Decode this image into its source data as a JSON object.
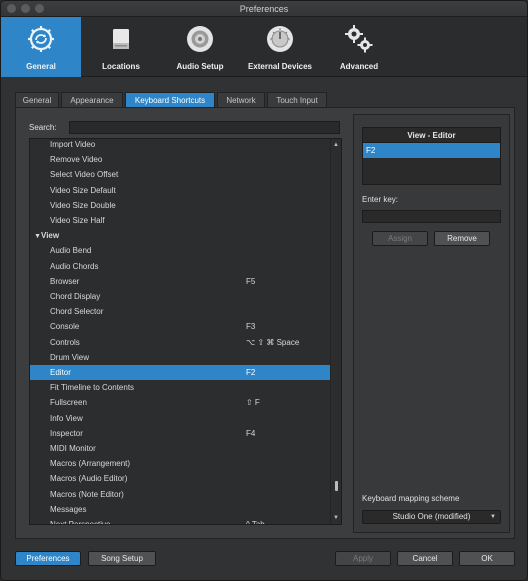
{
  "window": {
    "title": "Preferences"
  },
  "categories": [
    {
      "label": "General",
      "icon": "general-gear-icon"
    },
    {
      "label": "Locations",
      "icon": "hard-drive-icon"
    },
    {
      "label": "Audio Setup",
      "icon": "speaker-icon"
    },
    {
      "label": "External Devices",
      "icon": "knob-icon"
    },
    {
      "label": "Advanced",
      "icon": "gears-icon"
    }
  ],
  "tabs": [
    "General",
    "Appearance",
    "Keyboard Shortcuts",
    "Network",
    "Touch Input"
  ],
  "search": {
    "label": "Search:",
    "value": ""
  },
  "commands": [
    {
      "name": "Import Video",
      "key": ""
    },
    {
      "name": "Remove Video",
      "key": ""
    },
    {
      "name": "Select Video Offset",
      "key": ""
    },
    {
      "name": "Video Size Default",
      "key": ""
    },
    {
      "name": "Video Size Double",
      "key": ""
    },
    {
      "name": "Video Size Half",
      "key": ""
    },
    {
      "name": "View",
      "key": "",
      "group": true
    },
    {
      "name": "Audio Bend",
      "key": ""
    },
    {
      "name": "Audio Chords",
      "key": ""
    },
    {
      "name": "Browser",
      "key": "F5"
    },
    {
      "name": "Chord Display",
      "key": ""
    },
    {
      "name": "Chord Selector",
      "key": ""
    },
    {
      "name": "Console",
      "key": "F3"
    },
    {
      "name": "Controls",
      "key": "⌥ ⇧ ⌘ Space"
    },
    {
      "name": "Drum View",
      "key": ""
    },
    {
      "name": "Editor",
      "key": "F2",
      "selected": true
    },
    {
      "name": "Fit Timeline to Contents",
      "key": ""
    },
    {
      "name": "Fullscreen",
      "key": "⇧ F"
    },
    {
      "name": "Info View",
      "key": ""
    },
    {
      "name": "Inspector",
      "key": "F4"
    },
    {
      "name": "MIDI Monitor",
      "key": ""
    },
    {
      "name": "Macros (Arrangement)",
      "key": ""
    },
    {
      "name": "Macros (Audio Editor)",
      "key": ""
    },
    {
      "name": "Macros (Note Editor)",
      "key": ""
    },
    {
      "name": "Messages",
      "key": ""
    },
    {
      "name": "Next Perspective",
      "key": "^ Tab"
    }
  ],
  "assigned": {
    "title": "View - Editor",
    "keys": [
      "F2"
    ]
  },
  "enter_key": {
    "label": "Enter key:",
    "value": ""
  },
  "assign_button": "Assign",
  "remove_button": "Remove",
  "mapping": {
    "label": "Keyboard mapping scheme",
    "value": "Studio One (modified)"
  },
  "footer": {
    "preferences": "Preferences",
    "song_setup": "Song Setup",
    "apply": "Apply",
    "cancel": "Cancel",
    "ok": "OK"
  },
  "colors": {
    "accent": "#2e86c8",
    "background": "#313234"
  }
}
